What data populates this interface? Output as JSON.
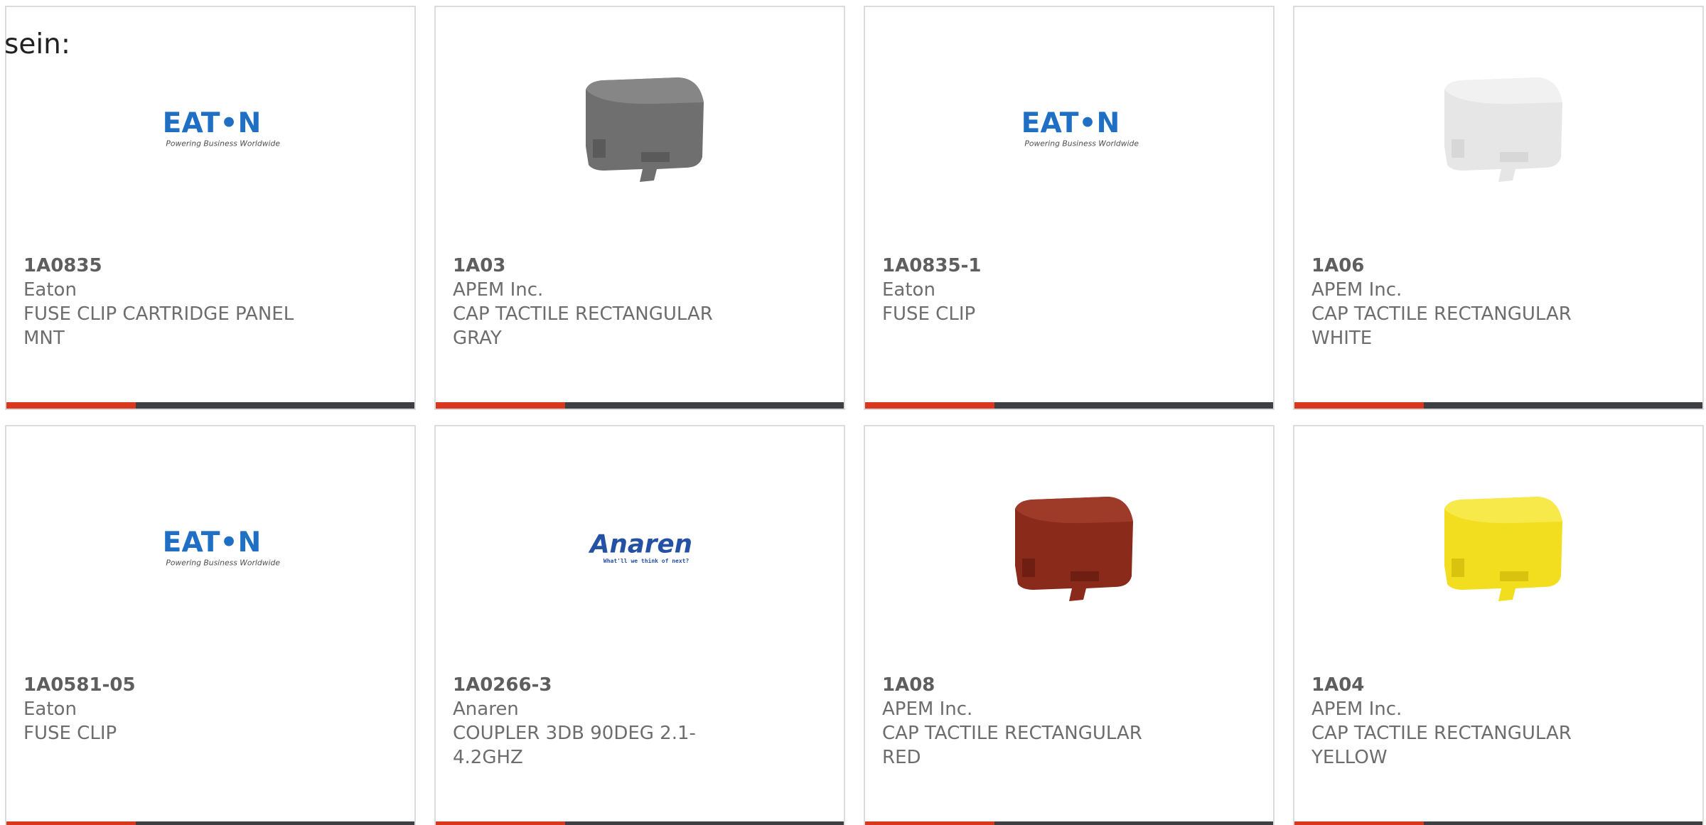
{
  "intro": "sein:",
  "colors": {
    "accent_bar": "#d9381e",
    "dark_bar": "#3d3f42",
    "card_border": "#dcdcdc",
    "eaton_blue": "#1f6fc4",
    "anaren_blue": "#2451a3",
    "cap_gray": "#6f6f6f",
    "cap_white": "#eeeeee",
    "cap_red": "#8a2a1a",
    "cap_yellow": "#f2de1f"
  },
  "eaton_logo": {
    "wordmark": "EAT•N",
    "tagline": "Powering Business Worldwide"
  },
  "anaren_logo": {
    "wordmark": "Anaren",
    "tagline": "What'll we think of next?"
  },
  "products": [
    {
      "part": "1A0835",
      "maker": "Eaton",
      "desc": "FUSE CLIP CARTRIDGE PANEL MNT",
      "image": "eaton-logo"
    },
    {
      "part": "1A03",
      "maker": "APEM Inc.",
      "desc": "CAP TACTILE RECTANGULAR GRAY",
      "image": "tactile-cap-gray"
    },
    {
      "part": "1A0835-1",
      "maker": "Eaton",
      "desc": "FUSE CLIP",
      "image": "eaton-logo"
    },
    {
      "part": "1A06",
      "maker": "APEM Inc.",
      "desc": "CAP TACTILE RECTANGULAR WHITE",
      "image": "tactile-cap-white"
    },
    {
      "part": "1A0581-05",
      "maker": "Eaton",
      "desc": "FUSE CLIP",
      "image": "eaton-logo"
    },
    {
      "part": "1A0266-3",
      "maker": "Anaren",
      "desc": "COUPLER 3DB 90DEG 2.1-4.2GHZ",
      "image": "anaren-logo"
    },
    {
      "part": "1A08",
      "maker": "APEM Inc.",
      "desc": "CAP TACTILE RECTANGULAR RED",
      "image": "tactile-cap-red"
    },
    {
      "part": "1A04",
      "maker": "APEM Inc.",
      "desc": "CAP TACTILE RECTANGULAR YELLOW",
      "image": "tactile-cap-yellow"
    }
  ]
}
